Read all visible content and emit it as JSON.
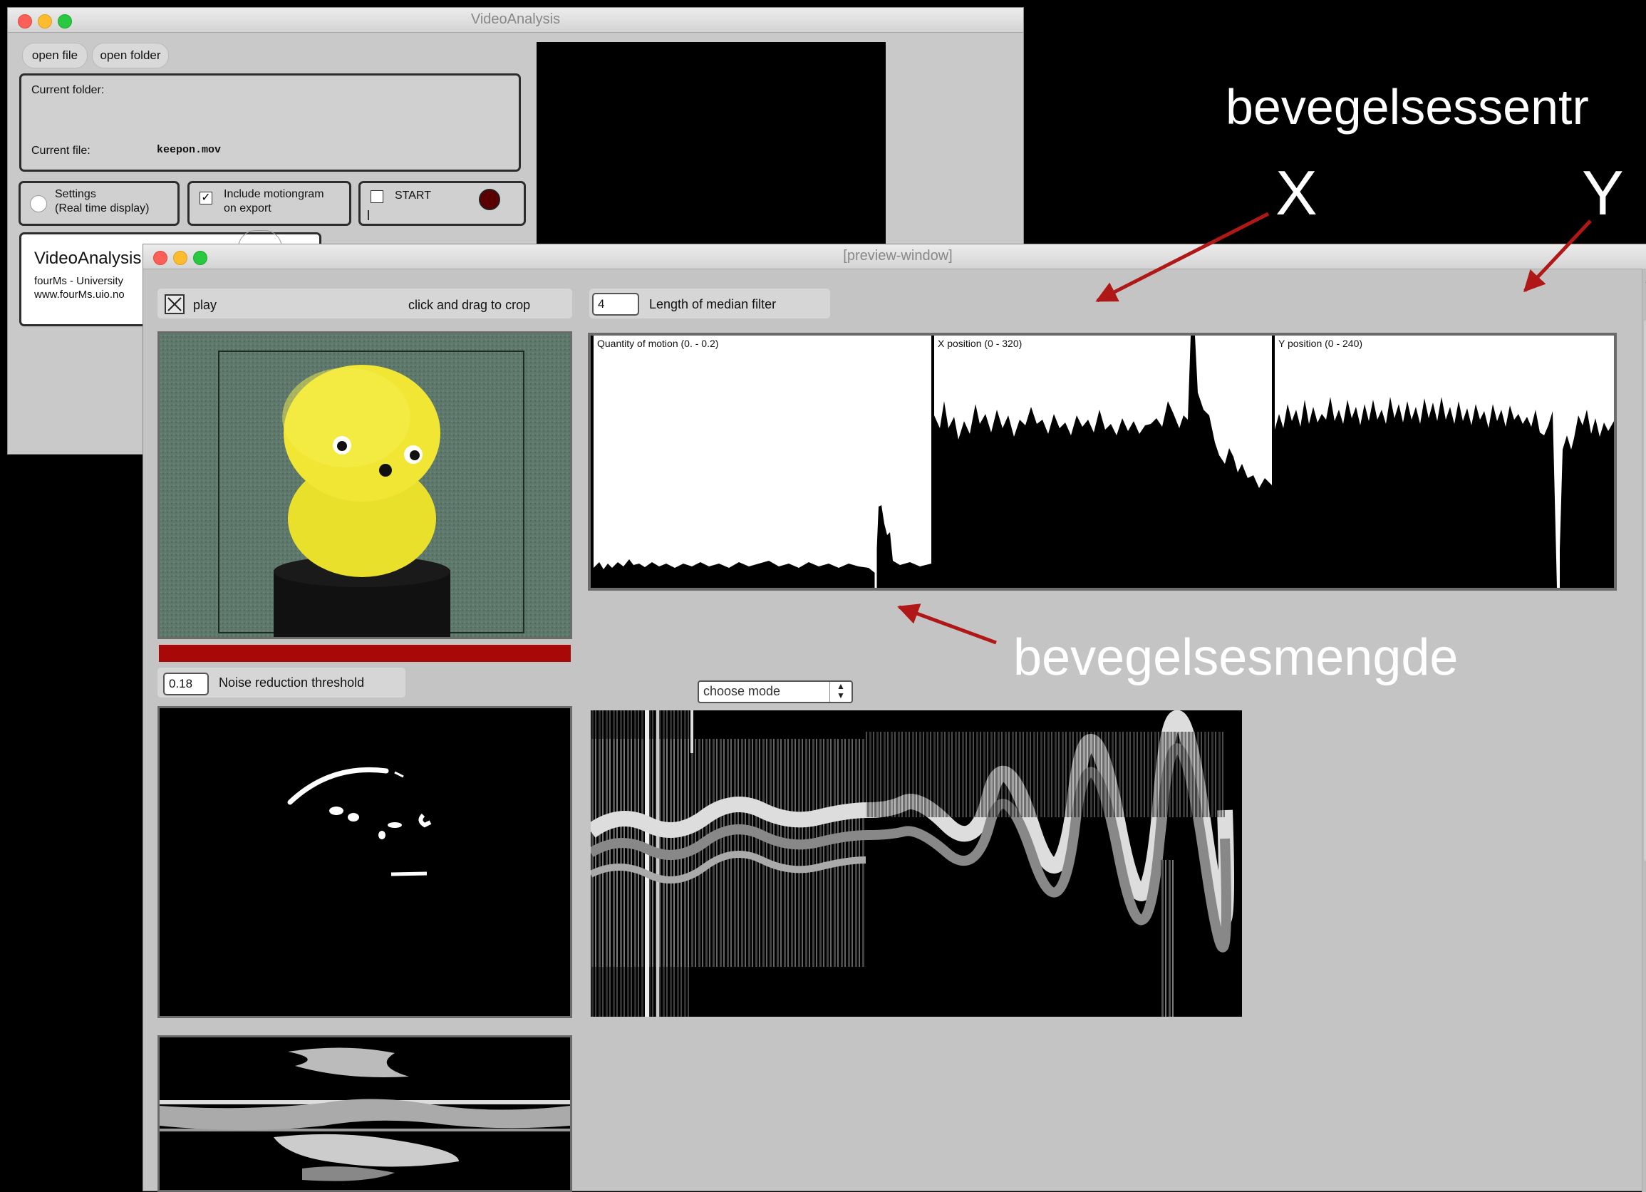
{
  "main_window": {
    "title": "VideoAnalysis",
    "buttons": {
      "open_file": "open file",
      "open_folder": "open folder"
    },
    "info": {
      "current_folder_label": "Current folder:",
      "current_file_label": "Current file:",
      "current_file_value": "keepon.mov"
    },
    "settings": {
      "line1": "Settings",
      "line2": "(Real time display)"
    },
    "motiongram": {
      "line1": "Include motiongram",
      "line2": "on export",
      "checked": true
    },
    "start": {
      "label": "START"
    },
    "about": {
      "title": "VideoAnalysis",
      "line1": "fourMs - University",
      "line2": "www.fourMs.uio.no"
    }
  },
  "preview_window": {
    "title": "[preview-window]",
    "play_label": "play",
    "crop_hint": "click and drag to crop",
    "median_filter": {
      "value": "4",
      "label": "Length of median filter"
    },
    "noise": {
      "value": "0.18",
      "label": "Noise reduction threshold"
    },
    "mode_dropdown": "choose mode",
    "graphs": [
      {
        "label": "Quantity of motion (0. - 0.2)"
      },
      {
        "label": "X position (0 - 320)"
      },
      {
        "label": "Y position (0 - 240)"
      }
    ]
  },
  "annotations": {
    "centroid": "bevegelsessentr",
    "x": "X",
    "y": "Y",
    "quantity": "bevegelsesmengde"
  },
  "colors": {
    "annotation_arrow": "#b01818",
    "progress_bar": "#a80808",
    "record_button": "#5a0000"
  }
}
